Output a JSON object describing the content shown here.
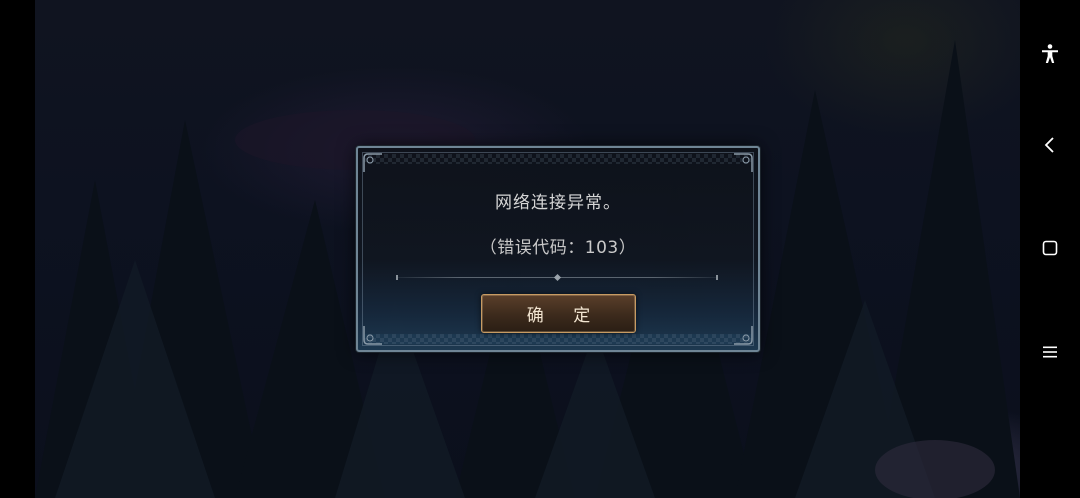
{
  "dialog": {
    "message": "网络连接异常。",
    "error_code": "（错误代码：103）",
    "confirm_label": "确 定"
  },
  "navbar": {
    "accessibility_icon": "accessibility-icon",
    "back_icon": "back-icon",
    "home_icon": "home-icon",
    "menu_icon": "menu-icon"
  },
  "colors": {
    "dialog_border": "#6f8595",
    "button_border": "#c79b63",
    "text": "#d6d6d6",
    "navbar": "#000000"
  }
}
